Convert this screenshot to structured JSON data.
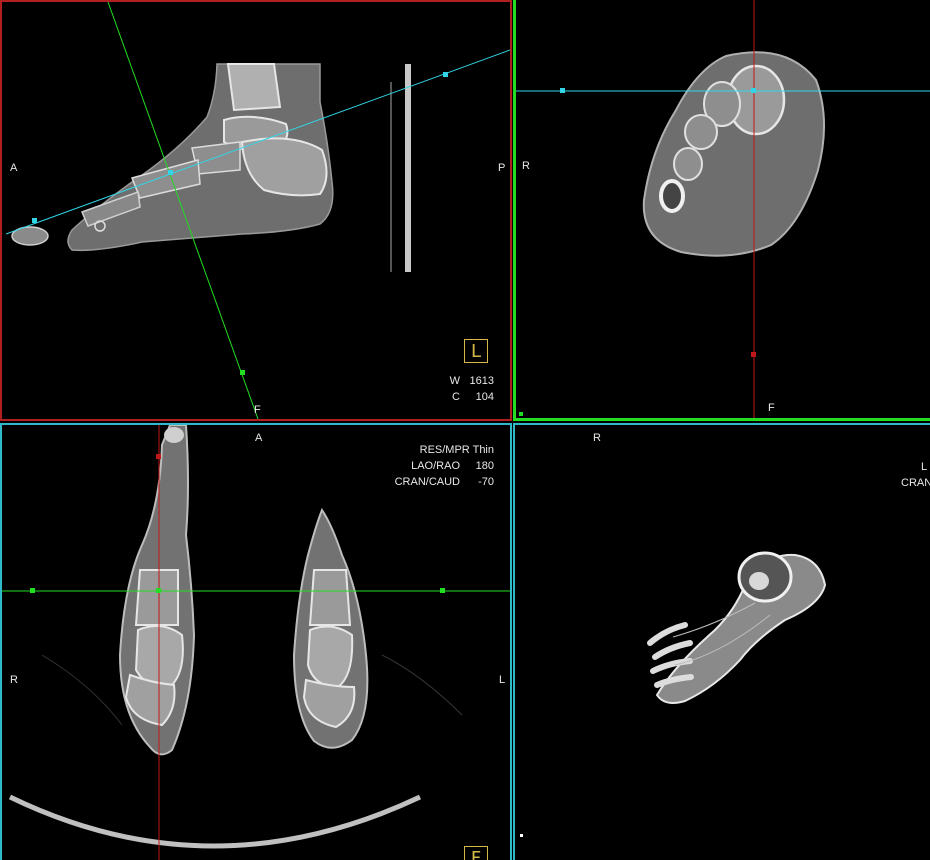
{
  "colors": {
    "sagittal_border": "#b02020",
    "coronal_border": "#22dd22",
    "axial_border": "#2fb9c9",
    "crosshair_cyan": "#31d5e6",
    "crosshair_green": "#22dd22",
    "crosshair_red": "#c01818",
    "orientation_box": "#d4b84a"
  },
  "sagittal": {
    "label_left": "A",
    "label_right": "P",
    "label_bottom": "F",
    "orientation_box": "L",
    "window_label": "W",
    "window_value": "1613",
    "center_label": "C",
    "center_value": "104"
  },
  "coronal": {
    "label_left": "R",
    "label_bottom": "F"
  },
  "axial": {
    "label_top": "A",
    "label_left": "R",
    "label_right": "L",
    "orientation_box": "F",
    "mode": "RES/MPR Thin",
    "lao_rao_label": "LAO/RAO",
    "lao_rao_value": "180",
    "cran_caud_label": "CRAN/CAUD",
    "cran_caud_value": "-70"
  },
  "volume3d": {
    "label_top": "R",
    "label_lao_partial": "L",
    "label_cran_partial": "CRAN"
  }
}
